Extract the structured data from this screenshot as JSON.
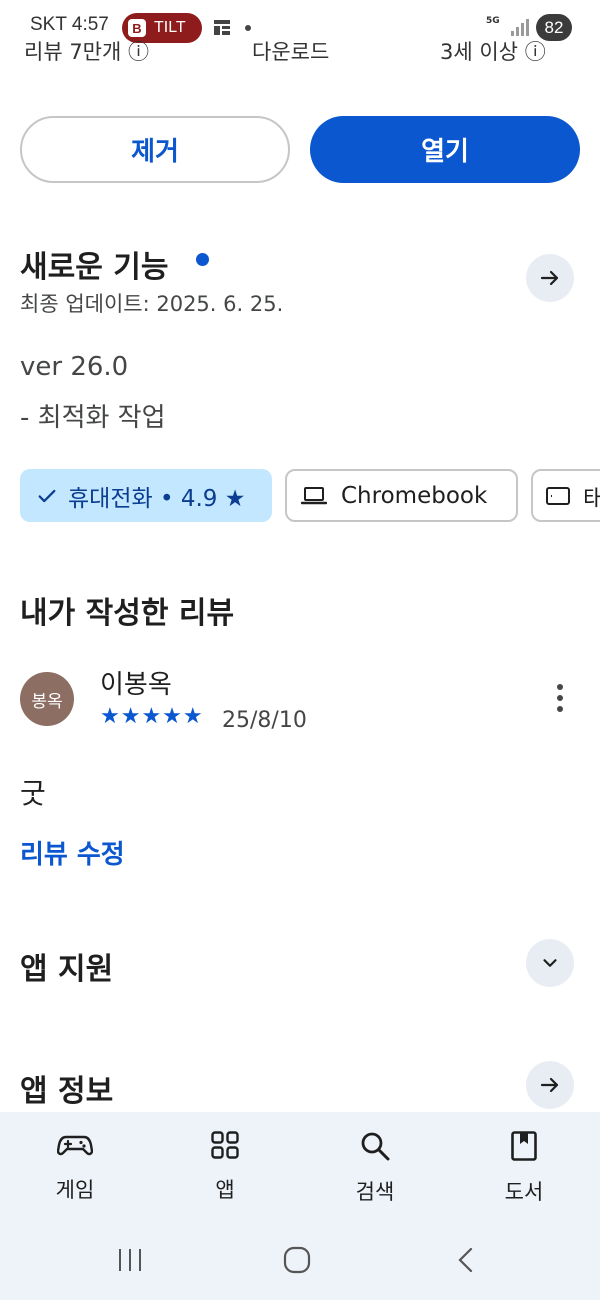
{
  "status_bar": {
    "carrier_time": "SKT 4:57",
    "tilt_badge": "TILT",
    "tilt_icon_letter": "B",
    "network": "5G",
    "battery": "82"
  },
  "stats_row": {
    "reviews": "리뷰 7만개",
    "downloads": "다운로드",
    "age": "3세 이상"
  },
  "actions": {
    "remove_label": "제거",
    "open_label": "열기"
  },
  "whats_new": {
    "title": "새로운 기능",
    "updated": "최종 업데이트: 2025. 6. 25.",
    "version": "ver 26.0",
    "notes": "- 최적화 작업"
  },
  "device_chips": [
    {
      "label": "휴대전화 • 4.9 ★",
      "selected": true
    },
    {
      "label": "Chromebook",
      "selected": false
    },
    {
      "label": "태",
      "selected": false
    }
  ],
  "my_review": {
    "title": "내가 작성한 리뷰",
    "avatar_text": "봉옥",
    "reviewer": "이봉옥",
    "stars": "★★★★★",
    "rating": 5,
    "date": "25/8/10",
    "body": "굿",
    "edit_label": "리뷰 수정"
  },
  "sections": {
    "app_support": "앱 지원",
    "app_info": "앱 정보"
  },
  "bottom_nav": [
    {
      "label": "게임",
      "icon": "gamepad-icon"
    },
    {
      "label": "앱",
      "icon": "apps-grid-icon"
    },
    {
      "label": "검색",
      "icon": "search-icon"
    },
    {
      "label": "도서",
      "icon": "book-icon"
    }
  ],
  "colors": {
    "accent": "#0b57d0",
    "chip_selected_bg": "#c2e7ff",
    "nav_bg": "#eef3f9",
    "avatar_bg": "#8d6e63"
  }
}
